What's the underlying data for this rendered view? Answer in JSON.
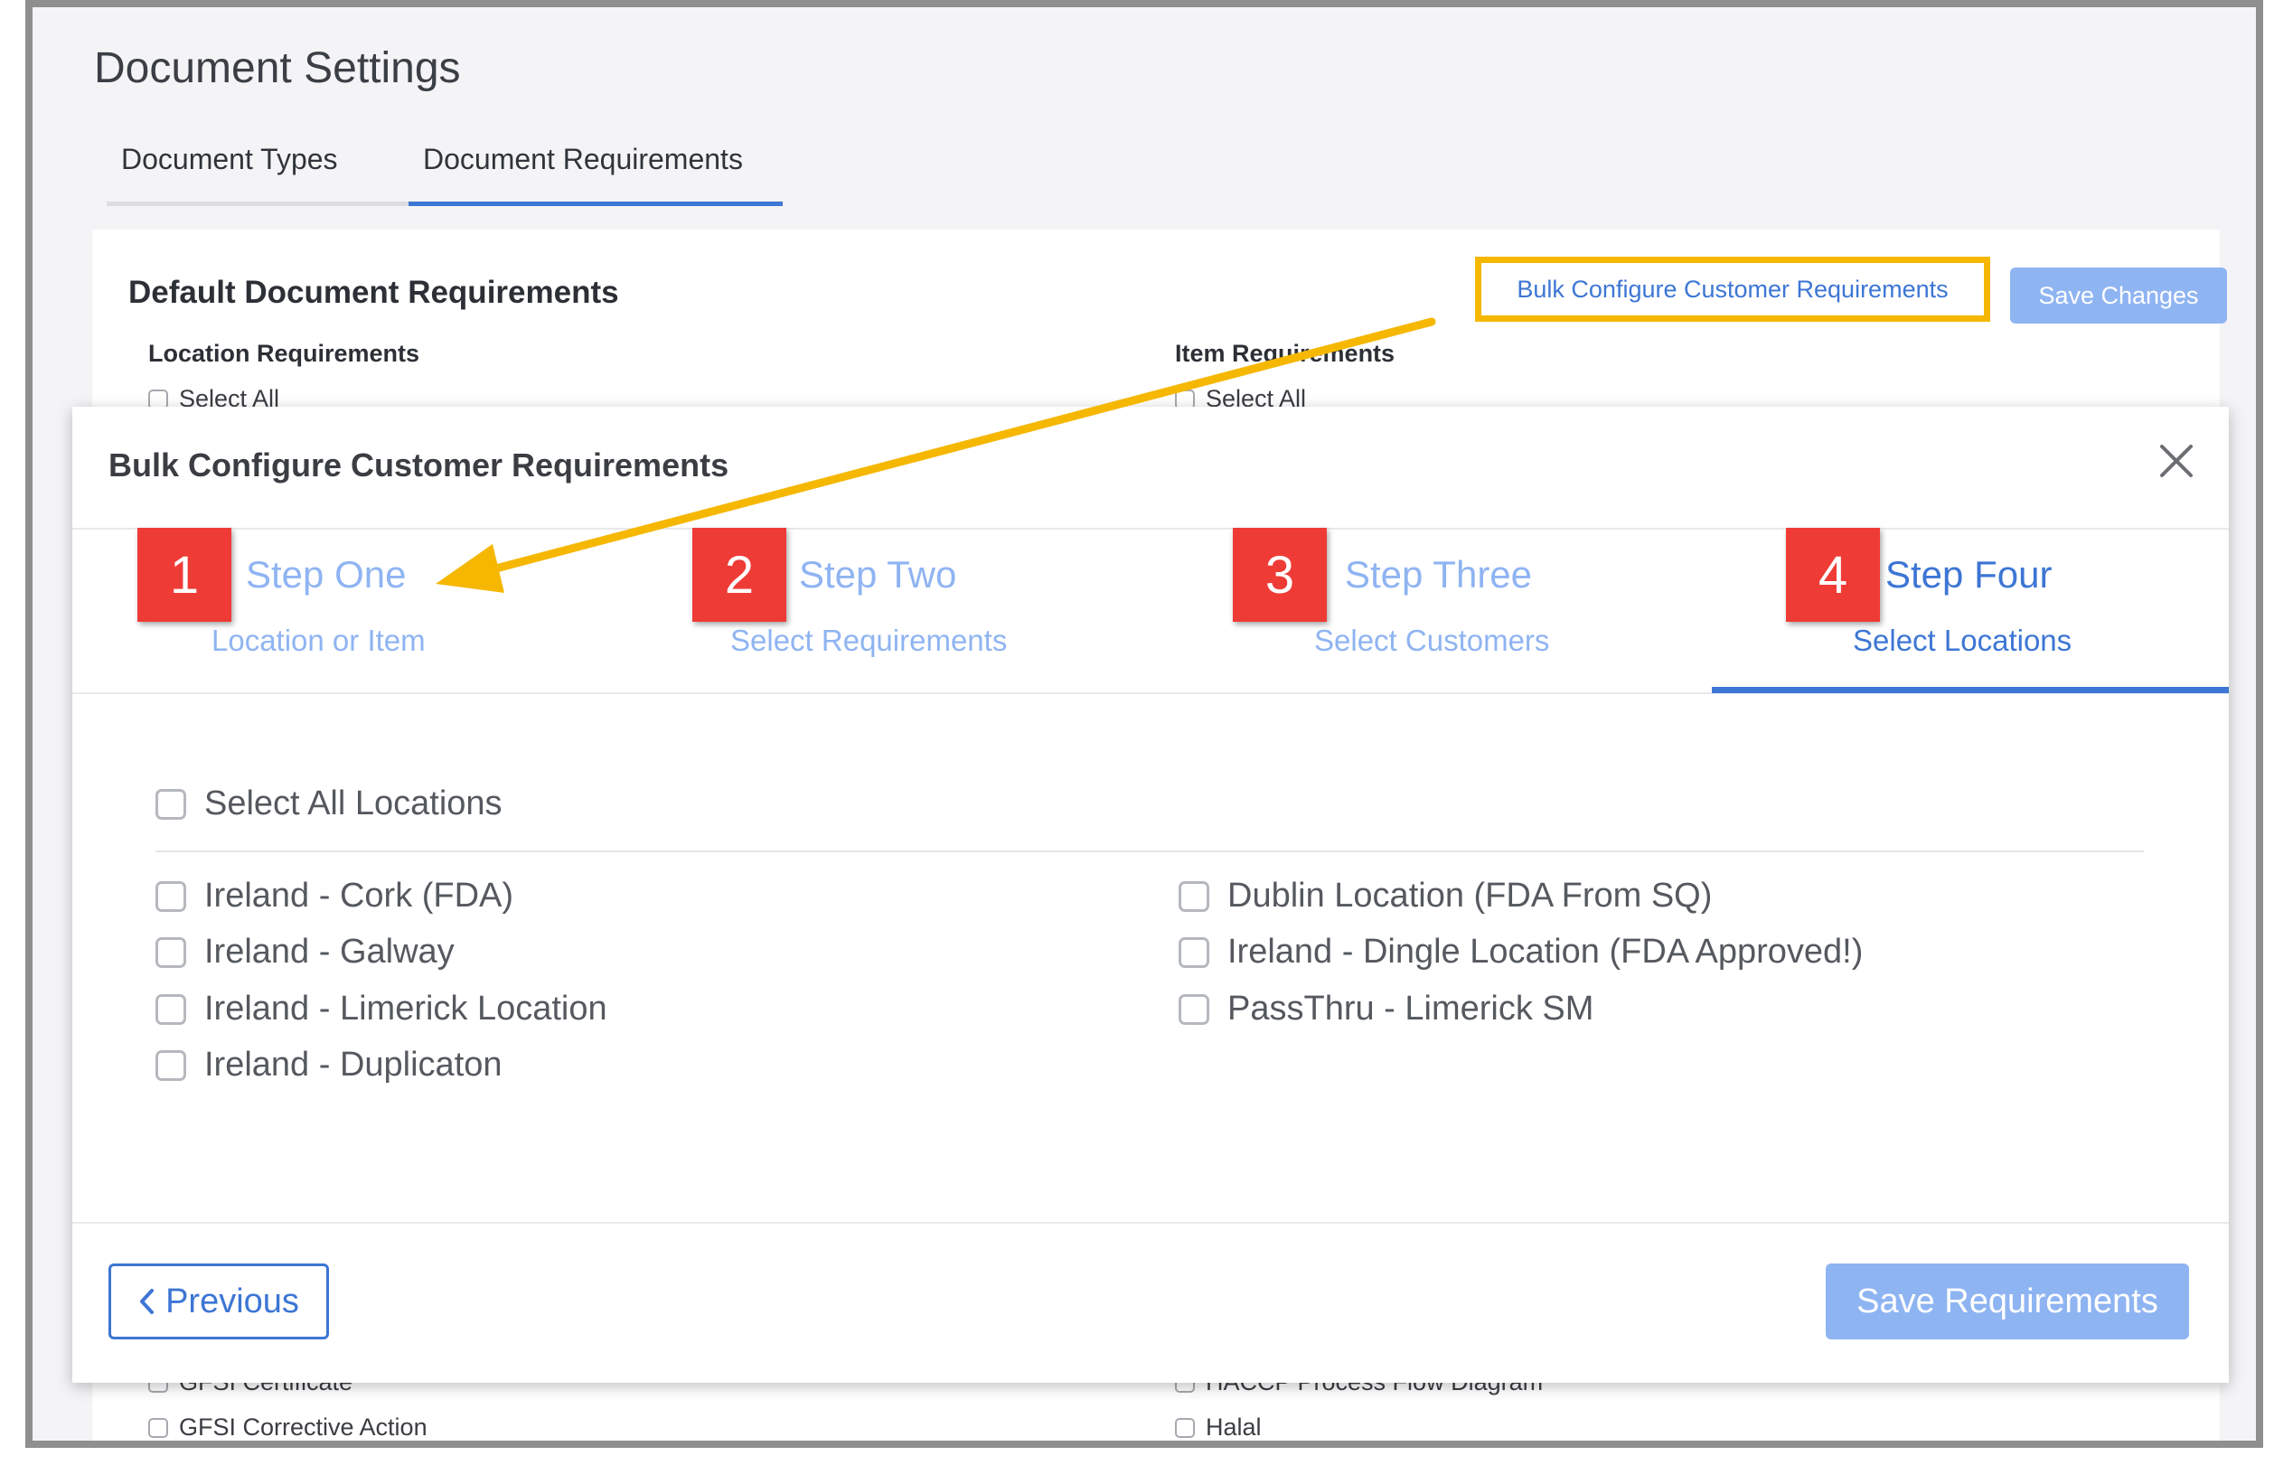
{
  "page": {
    "title": "Document Settings",
    "tabs": [
      {
        "label": "Document Types"
      },
      {
        "label": "Document Requirements"
      }
    ]
  },
  "card": {
    "title": "Default Document Requirements",
    "bulk_button": "Bulk Configure Customer Requirements",
    "save_button": "Save Changes",
    "location_requirements": "Location Requirements",
    "item_requirements": "Item Requirements",
    "select_all": "Select All",
    "left_items": [
      "GFSI Certificate",
      "GFSI Corrective Action"
    ],
    "right_items": [
      "HACCP Process Flow Diagram",
      "Halal"
    ]
  },
  "modal": {
    "title": "Bulk Configure Customer Requirements",
    "steps": [
      {
        "number": "1",
        "title": "Step One",
        "subtitle": "Location or Item"
      },
      {
        "number": "2",
        "title": "Step Two",
        "subtitle": "Select Requirements"
      },
      {
        "number": "3",
        "title": "Step Three",
        "subtitle": "Select Customers"
      },
      {
        "number": "4",
        "title": "Step Four",
        "subtitle": "Select Locations"
      }
    ],
    "select_all_label": "Select All Locations",
    "locations_left": [
      "Ireland - Cork (FDA)",
      "Ireland - Galway",
      "Ireland - Limerick Location",
      "Ireland - Duplicaton"
    ],
    "locations_right": [
      "Dublin Location (FDA From SQ)",
      "Ireland - Dingle Location (FDA Approved!)",
      "PassThru - Limerick SM"
    ],
    "previous_button": "Previous",
    "save_button": "Save Requirements"
  },
  "colors": {
    "accent": "#3d76d4",
    "accent_light": "#8fb4f2",
    "badge": "#ef3b36",
    "highlight": "#f5b700"
  }
}
